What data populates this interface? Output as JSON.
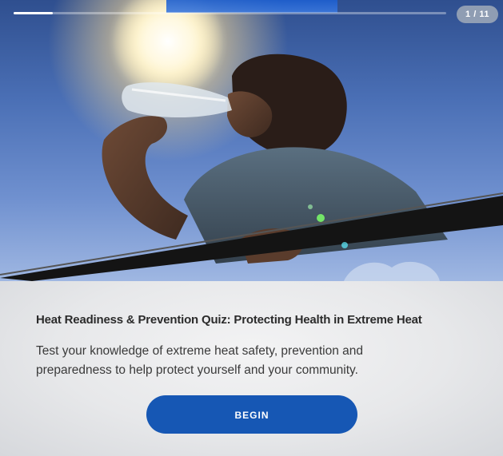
{
  "quiz": {
    "counter": "1 / 11",
    "progress_fraction": 0.09,
    "hero_image": "person-drinking-water-in-sun",
    "title": "Heat Readiness & Prevention Quiz: Protecting Health in Extreme Heat",
    "description": "Test your knowledge of extreme heat safety, prevention and preparedness to help protect yourself and your community.",
    "begin_label": "BEGIN"
  },
  "colors": {
    "button": "#1657b4",
    "title_text": "#2b2b2b",
    "body_text": "#3a3a3a",
    "badge": "#a0aab9"
  }
}
